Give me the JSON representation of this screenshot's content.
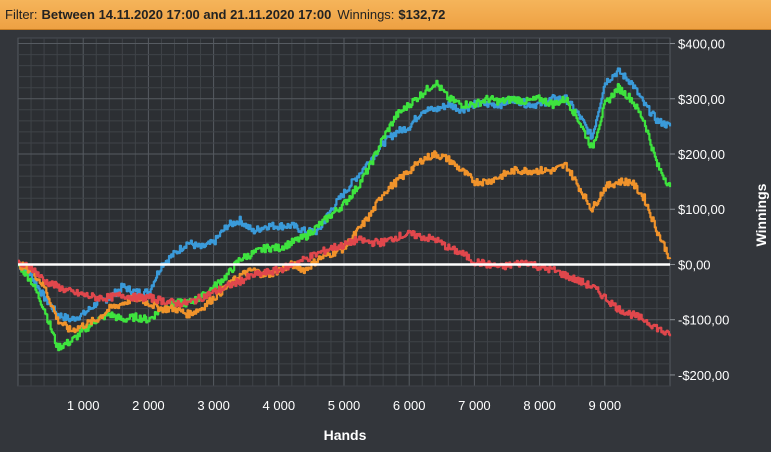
{
  "filter": {
    "filter_label": "Filter:",
    "filter_value": "Between 14.11.2020 17:00 and 21.11.2020 17:00",
    "winnings_label": "Winnings:",
    "winnings_value": "$132,72"
  },
  "colors": {
    "background": "#33363b",
    "plot": "#2c2f33",
    "filter_bar": "#f0a646",
    "zero_line": "#ffffff",
    "blue": "#3a9ad9",
    "green": "#3ee33e",
    "orange": "#f0932b",
    "red": "#e0474c"
  },
  "chart_data": {
    "type": "line",
    "xlabel": "Hands",
    "ylabel": "Winnings",
    "xlim": [
      0,
      10000
    ],
    "ylim": [
      -220,
      410
    ],
    "x_ticks": [
      1000,
      2000,
      3000,
      4000,
      5000,
      6000,
      7000,
      8000,
      9000
    ],
    "x_tick_labels": [
      "1 000",
      "2 000",
      "3 000",
      "4 000",
      "5 000",
      "6 000",
      "7 000",
      "8 000",
      "9 000"
    ],
    "y_ticks": [
      400,
      300,
      200,
      100,
      0,
      -100,
      -200
    ],
    "y_tick_labels": [
      "$400,00",
      "$300,00",
      "$200,00",
      "$100,00",
      "$0,00",
      "-$100,00",
      "-$200,00"
    ],
    "grid": true,
    "zero_line": true,
    "series": [
      {
        "color": "#3a9ad9",
        "points": [
          [
            0,
            0
          ],
          [
            200,
            -20
          ],
          [
            400,
            -60
          ],
          [
            600,
            -90
          ],
          [
            800,
            -100
          ],
          [
            1000,
            -90
          ],
          [
            1200,
            -70
          ],
          [
            1400,
            -60
          ],
          [
            1600,
            -40
          ],
          [
            1800,
            -50
          ],
          [
            2000,
            -50
          ],
          [
            2200,
            0
          ],
          [
            2400,
            20
          ],
          [
            2600,
            40
          ],
          [
            2800,
            30
          ],
          [
            3000,
            40
          ],
          [
            3200,
            70
          ],
          [
            3400,
            80
          ],
          [
            3600,
            60
          ],
          [
            3800,
            70
          ],
          [
            4000,
            70
          ],
          [
            4200,
            70
          ],
          [
            4400,
            60
          ],
          [
            4600,
            60
          ],
          [
            4800,
            100
          ],
          [
            5000,
            130
          ],
          [
            5200,
            160
          ],
          [
            5400,
            190
          ],
          [
            5600,
            220
          ],
          [
            5800,
            240
          ],
          [
            6000,
            250
          ],
          [
            6200,
            280
          ],
          [
            6400,
            280
          ],
          [
            6600,
            290
          ],
          [
            6800,
            280
          ],
          [
            7000,
            290
          ],
          [
            7200,
            290
          ],
          [
            7400,
            290
          ],
          [
            7600,
            300
          ],
          [
            7800,
            290
          ],
          [
            8000,
            290
          ],
          [
            8200,
            300
          ],
          [
            8400,
            300
          ],
          [
            8600,
            270
          ],
          [
            8800,
            230
          ],
          [
            9000,
            330
          ],
          [
            9200,
            350
          ],
          [
            9400,
            330
          ],
          [
            9600,
            290
          ],
          [
            9800,
            260
          ],
          [
            10000,
            250
          ]
        ]
      },
      {
        "color": "#3ee33e",
        "points": [
          [
            0,
            0
          ],
          [
            200,
            -30
          ],
          [
            400,
            -80
          ],
          [
            600,
            -150
          ],
          [
            800,
            -140
          ],
          [
            1000,
            -120
          ],
          [
            1200,
            -100
          ],
          [
            1400,
            -90
          ],
          [
            1600,
            -100
          ],
          [
            1800,
            -95
          ],
          [
            2000,
            -100
          ],
          [
            2200,
            -80
          ],
          [
            2400,
            -70
          ],
          [
            2600,
            -70
          ],
          [
            2800,
            -60
          ],
          [
            3000,
            -40
          ],
          [
            3200,
            -20
          ],
          [
            3400,
            10
          ],
          [
            3600,
            20
          ],
          [
            3800,
            30
          ],
          [
            4000,
            30
          ],
          [
            4200,
            40
          ],
          [
            4400,
            50
          ],
          [
            4600,
            70
          ],
          [
            4800,
            90
          ],
          [
            5000,
            110
          ],
          [
            5200,
            140
          ],
          [
            5400,
            180
          ],
          [
            5600,
            230
          ],
          [
            5800,
            270
          ],
          [
            6000,
            290
          ],
          [
            6200,
            310
          ],
          [
            6400,
            330
          ],
          [
            6600,
            300
          ],
          [
            6800,
            290
          ],
          [
            7000,
            290
          ],
          [
            7200,
            300
          ],
          [
            7400,
            295
          ],
          [
            7600,
            300
          ],
          [
            7800,
            295
          ],
          [
            8000,
            300
          ],
          [
            8200,
            290
          ],
          [
            8400,
            300
          ],
          [
            8600,
            260
          ],
          [
            8800,
            210
          ],
          [
            9000,
            290
          ],
          [
            9200,
            320
          ],
          [
            9400,
            300
          ],
          [
            9600,
            260
          ],
          [
            9800,
            180
          ],
          [
            10000,
            140
          ]
        ]
      },
      {
        "color": "#f0932b",
        "points": [
          [
            0,
            0
          ],
          [
            200,
            -10
          ],
          [
            400,
            -40
          ],
          [
            600,
            -100
          ],
          [
            800,
            -120
          ],
          [
            1000,
            -110
          ],
          [
            1200,
            -100
          ],
          [
            1400,
            -80
          ],
          [
            1600,
            -70
          ],
          [
            1800,
            -60
          ],
          [
            2000,
            -70
          ],
          [
            2200,
            -80
          ],
          [
            2400,
            -80
          ],
          [
            2600,
            -90
          ],
          [
            2800,
            -80
          ],
          [
            3000,
            -60
          ],
          [
            3200,
            -40
          ],
          [
            3400,
            -20
          ],
          [
            3600,
            -10
          ],
          [
            3800,
            -20
          ],
          [
            4000,
            -10
          ],
          [
            4200,
            0
          ],
          [
            4400,
            -10
          ],
          [
            4600,
            10
          ],
          [
            4800,
            20
          ],
          [
            5000,
            30
          ],
          [
            5200,
            60
          ],
          [
            5400,
            90
          ],
          [
            5600,
            130
          ],
          [
            5800,
            150
          ],
          [
            6000,
            170
          ],
          [
            6200,
            190
          ],
          [
            6400,
            200
          ],
          [
            6600,
            190
          ],
          [
            6800,
            170
          ],
          [
            7000,
            150
          ],
          [
            7200,
            150
          ],
          [
            7400,
            160
          ],
          [
            7600,
            170
          ],
          [
            7800,
            170
          ],
          [
            8000,
            170
          ],
          [
            8200,
            170
          ],
          [
            8400,
            180
          ],
          [
            8600,
            140
          ],
          [
            8800,
            100
          ],
          [
            9000,
            140
          ],
          [
            9200,
            150
          ],
          [
            9400,
            150
          ],
          [
            9600,
            120
          ],
          [
            9800,
            60
          ],
          [
            10000,
            10
          ]
        ]
      },
      {
        "color": "#e0474c",
        "points": [
          [
            0,
            0
          ],
          [
            200,
            -5
          ],
          [
            400,
            -30
          ],
          [
            600,
            -40
          ],
          [
            800,
            -50
          ],
          [
            1000,
            -55
          ],
          [
            1200,
            -60
          ],
          [
            1400,
            -60
          ],
          [
            1600,
            -55
          ],
          [
            1800,
            -60
          ],
          [
            2000,
            -60
          ],
          [
            2200,
            -65
          ],
          [
            2400,
            -70
          ],
          [
            2600,
            -70
          ],
          [
            2800,
            -60
          ],
          [
            3000,
            -50
          ],
          [
            3200,
            -40
          ],
          [
            3400,
            -30
          ],
          [
            3600,
            -20
          ],
          [
            3800,
            -15
          ],
          [
            4000,
            -10
          ],
          [
            4200,
            0
          ],
          [
            4400,
            10
          ],
          [
            4600,
            20
          ],
          [
            4800,
            30
          ],
          [
            5000,
            35
          ],
          [
            5200,
            45
          ],
          [
            5400,
            40
          ],
          [
            5600,
            40
          ],
          [
            5800,
            50
          ],
          [
            6000,
            55
          ],
          [
            6200,
            50
          ],
          [
            6400,
            45
          ],
          [
            6600,
            30
          ],
          [
            6800,
            20
          ],
          [
            7000,
            5
          ],
          [
            7200,
            0
          ],
          [
            7400,
            -5
          ],
          [
            7600,
            0
          ],
          [
            7800,
            5
          ],
          [
            8000,
            -5
          ],
          [
            8200,
            -10
          ],
          [
            8400,
            -20
          ],
          [
            8600,
            -30
          ],
          [
            8800,
            -40
          ],
          [
            9000,
            -60
          ],
          [
            9200,
            -80
          ],
          [
            9400,
            -90
          ],
          [
            9600,
            -100
          ],
          [
            9800,
            -115
          ],
          [
            10000,
            -130
          ]
        ]
      }
    ]
  }
}
